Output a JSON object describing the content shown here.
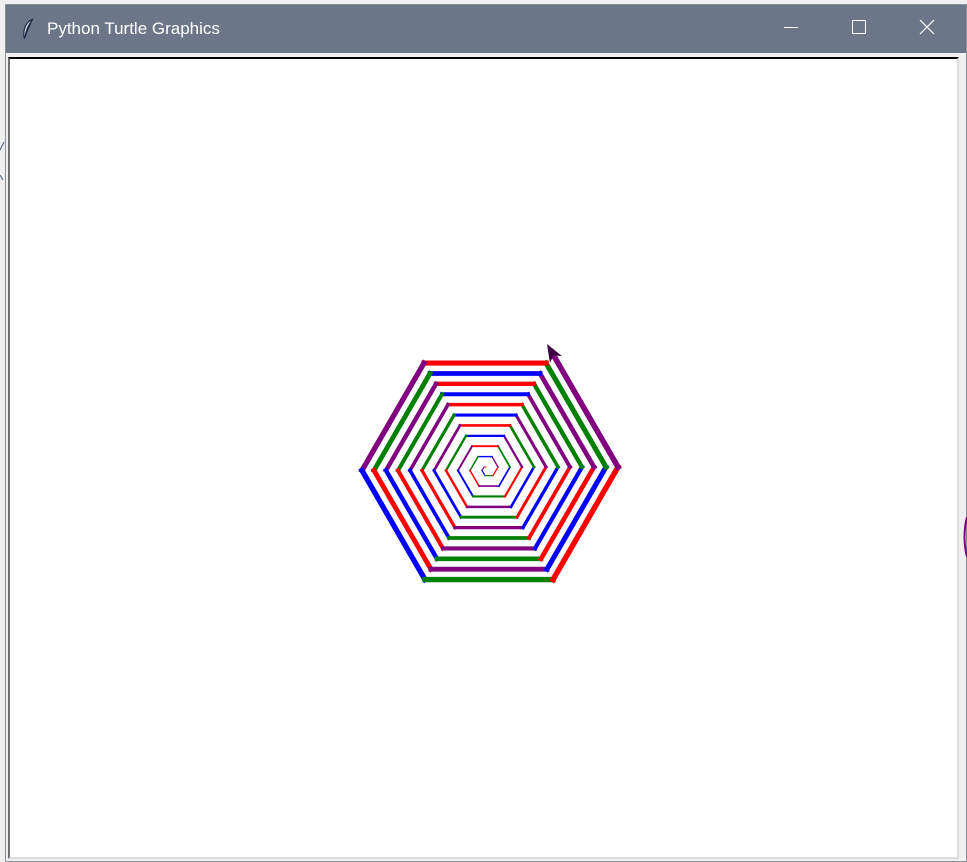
{
  "window": {
    "title": "Python Turtle Graphics",
    "icon": "feather-icon",
    "controls": [
      "minimize-icon",
      "maximize-icon",
      "close-icon"
    ]
  },
  "canvas": {
    "background": "#ffffff",
    "drawing": "hexagonal-spiral",
    "pen_colors": [
      "#ff0000",
      "#800080",
      "#0000ff",
      "#008000"
    ],
    "turtle_cursor": "arrow-icon"
  },
  "colors": {
    "titlebar": "#6b7788",
    "title_text": "#ffffff"
  }
}
